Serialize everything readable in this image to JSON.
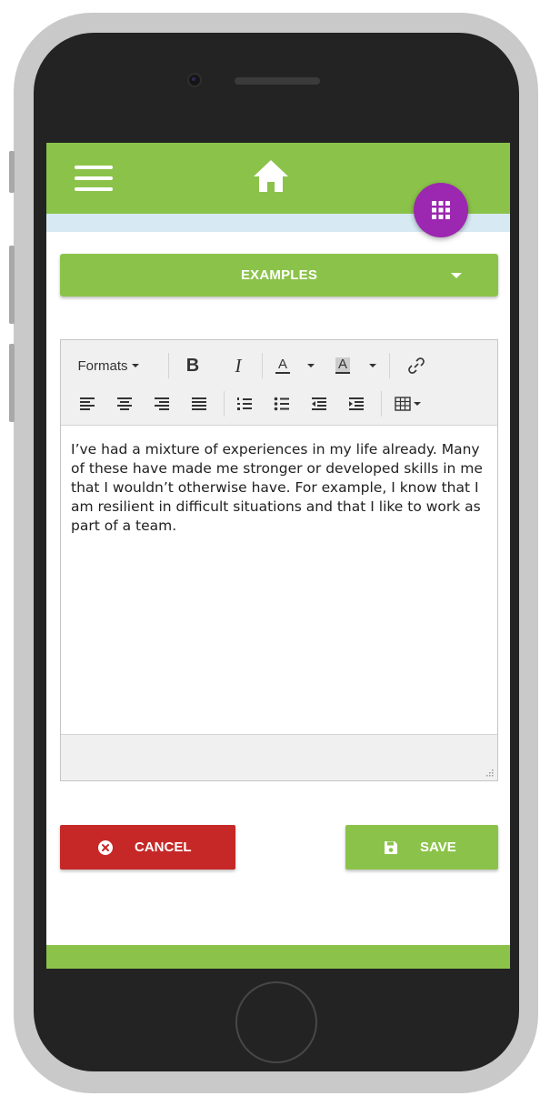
{
  "colors": {
    "brand_green": "#8bc34a",
    "fab_purple": "#9c27b0",
    "cancel_red": "#c62828",
    "header_strip": "#d7eaf3"
  },
  "header": {
    "menu_icon": "hamburger-icon",
    "home_icon": "home-icon",
    "fab_icon": "grid-icon"
  },
  "examples": {
    "label": "EXAMPLES",
    "icon": "caret-down-icon"
  },
  "toolbar": {
    "formats_label": "Formats",
    "bold_label": "B",
    "italic_label": "I",
    "text_color_label": "A",
    "bg_color_label": "A",
    "row1_icons": [
      "bold-icon",
      "italic-icon",
      "text-color-icon",
      "background-color-icon",
      "link-icon"
    ],
    "row2_icons": [
      "align-left-icon",
      "align-center-icon",
      "align-right-icon",
      "align-justify-icon",
      "numbered-list-icon",
      "bullet-list-icon",
      "outdent-icon",
      "indent-icon",
      "table-icon"
    ]
  },
  "editor": {
    "content": "I’ve had a mixture of experiences in my life already. Many of these have made me stronger or developed skills in me that I wouldn’t otherwise have. For example, I know that I am resilient in difficult situations and that I like to work as part of a team."
  },
  "actions": {
    "cancel_label": "CANCEL",
    "cancel_icon": "close-circle-icon",
    "save_label": "SAVE",
    "save_icon": "floppy-disk-icon"
  }
}
